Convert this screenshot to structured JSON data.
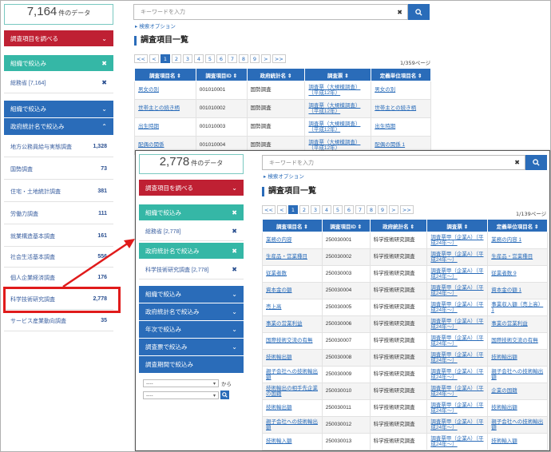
{
  "left": {
    "count_num": "7,164",
    "count_unit": "件のデータ",
    "bar_survey_items": "調査項目を調べる",
    "bar_org_narrow": "組織で絞込み",
    "org_selected": "総務省 [7,164]",
    "bar_org_narrow2": "組織で絞込み",
    "bar_stats_narrow": "政府統計名で絞込み",
    "stats_list": [
      {
        "name": "地方公務員給与実態調査",
        "count": "1,328"
      },
      {
        "name": "国勢調査",
        "count": "73"
      },
      {
        "name": "住宅・土地統計調査",
        "count": "381"
      },
      {
        "name": "労働力調査",
        "count": "111"
      },
      {
        "name": "就業構造基本調査",
        "count": "161"
      },
      {
        "name": "社会生活基本調査",
        "count": "556"
      },
      {
        "name": "個人企業経済調査",
        "count": "176"
      },
      {
        "name": "科学技術研究調査",
        "count": "2,778"
      },
      {
        "name": "サービス産業動向調査",
        "count": "35"
      }
    ],
    "search_placeholder": "キーワードを入力",
    "search_option": "検索オプション",
    "list_title": "調査項目一覧",
    "pager": [
      "<<",
      "<",
      "1",
      "2",
      "3",
      "4",
      "5",
      "6",
      "7",
      "8",
      "9",
      ">",
      ">>"
    ],
    "page_count": "1/359ページ",
    "headers": [
      "調査項目名",
      "調査項目ID",
      "政府統計名",
      "調査票",
      "定義単位項目名"
    ],
    "rows": [
      [
        "男女の別",
        "001010001",
        "国勢調査",
        "調査票（大規模調査）（平成12年）",
        "男女の別"
      ],
      [
        "世帯主との続き柄",
        "001010002",
        "国勢調査",
        "調査票（大規模調査）（平成12年）",
        "世帯主との続き柄"
      ],
      [
        "出生時期",
        "001010003",
        "国勢調査",
        "調査票（大規模調査）（平成12年）",
        "出生時期"
      ],
      [
        "配偶の関係",
        "001010004",
        "国勢調査",
        "調査票（大規模調査）（平成12年）",
        "配偶の関係 1"
      ]
    ]
  },
  "right": {
    "count_num": "2,778",
    "count_unit": "件のデータ",
    "bar_survey_items": "調査項目を調べる",
    "bar_org_narrow": "組織で絞込み",
    "org_selected": "総務省 [2,778]",
    "bar_stats_narrow": "政府統計名で絞込み",
    "stats_selected": "科学技術研究調査 [2,778]",
    "bar_org_narrow2": "組織で絞込み",
    "bar_stats_narrow2": "政府統計名で絞込み",
    "bar_year": "年次で絞込み",
    "bar_form": "調査票で絞込み",
    "bar_period": "調査期間で絞込み",
    "period_from": "から",
    "select_placeholder": "----",
    "search_placeholder": "キーワードを入力",
    "search_option": "検索オプション",
    "list_title": "調査項目一覧",
    "pager": [
      "<<",
      "<",
      "1",
      "2",
      "3",
      "4",
      "5",
      "6",
      "7",
      "8",
      "9",
      ">",
      ">>"
    ],
    "page_count": "1/139ページ",
    "headers": [
      "調査項目名",
      "調査項目ID",
      "政府統計名",
      "調査票",
      "定義単位項目名"
    ],
    "rows": [
      [
        "業務の内容",
        "250030001",
        "科学技術研究調査",
        "調査票甲（企業A）（平成24年〜）",
        "業務の内容 1"
      ],
      [
        "生産品・営業種目",
        "250030002",
        "科学技術研究調査",
        "調査票甲（企業A）（平成24年〜）",
        "生産品・営業種目"
      ],
      [
        "従業者数",
        "250030003",
        "科学技術研究調査",
        "調査票甲（企業A）（平成24年〜）",
        "従業者数 9"
      ],
      [
        "資本金の額",
        "250030004",
        "科学技術研究調査",
        "調査票甲（企業A）（平成24年〜）",
        "資本金の額 1"
      ],
      [
        "売上高",
        "250030005",
        "科学技術研究調査",
        "調査票甲（企業A）（平成24年〜）",
        "事業収入額（売上高）1"
      ],
      [
        "事業の営業利益",
        "250030006",
        "科学技術研究調査",
        "調査票甲（企業A）（平成24年〜）",
        "事業の営業利益"
      ],
      [
        "国際技術交流の有無",
        "250030007",
        "科学技術研究調査",
        "調査票甲（企業A）（平成24年〜）",
        "国際技術交流の有無"
      ],
      [
        "技術輸出額",
        "250030008",
        "科学技術研究調査",
        "調査票甲（企業A）（平成24年〜）",
        "技術輸出額"
      ],
      [
        "親子会社への技術輸出額",
        "250030009",
        "科学技術研究調査",
        "調査票甲（企業A）（平成24年〜）",
        "親子会社への技術輸出額"
      ],
      [
        "技術輸出の相手先企業の国籍",
        "250030010",
        "科学技術研究調査",
        "調査票甲（企業A）（平成24年〜）",
        "企業の国籍"
      ],
      [
        "技術輸出額",
        "250030011",
        "科学技術研究調査",
        "調査票甲（企業A）（平成24年〜）",
        "技術輸出額"
      ],
      [
        "親子会社への技術輸出額",
        "250030012",
        "科学技術研究調査",
        "調査票甲（企業A）（平成24年〜）",
        "親子会社への技術輸出額"
      ],
      [
        "技術輸入額",
        "250030013",
        "科学技術研究調査",
        "調査票甲（企業A）（平成24年〜）",
        "技術輸入額"
      ]
    ]
  }
}
